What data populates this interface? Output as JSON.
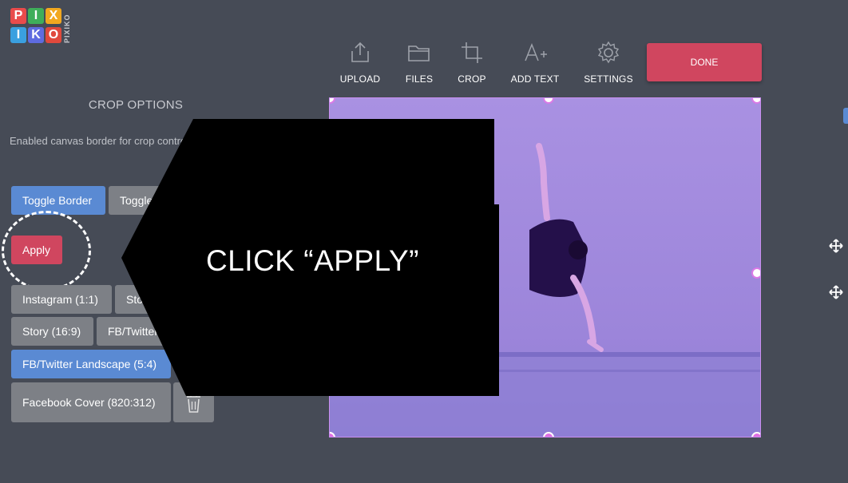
{
  "logo": {
    "letters": [
      "P",
      "I",
      "X",
      "I",
      "K",
      "O"
    ],
    "colors": [
      "#e94b4b",
      "#3fae5a",
      "#f2a81f",
      "#3aa0e0",
      "#5e6be0",
      "#e0493c"
    ],
    "vertical_text": "PIXIKO"
  },
  "toolbar": {
    "upload_label": "UPLOAD",
    "files_label": "FILES",
    "crop_label": "CROP",
    "add_text_label": "ADD TEXT",
    "settings_label": "SETTINGS",
    "done_label": "DONE"
  },
  "crop_panel": {
    "title": "CROP OPTIONS",
    "description": " Enabled canvas border for crop control.",
    "toggle_border_label": "Toggle Border",
    "toggle_second_label": "Toggle",
    "apply_label": "Apply",
    "presets": [
      {
        "label": "Instagram (1:1)"
      },
      {
        "label": "Story"
      },
      {
        "label": "Story (16:9)"
      },
      {
        "label": "FB/Twitter"
      },
      {
        "label": "FB/Twitter Landscape (5:4)"
      },
      {
        "label": "Facebook Cover (820:312)"
      }
    ]
  },
  "overlay": {
    "text": "CLICK “APPLY”"
  },
  "colors": {
    "background": "#464b56",
    "accent_red": "#d0465f",
    "accent_blue": "#5a8ad3",
    "button_gray": "#7d8086",
    "canvas_tint": "#a08ade"
  },
  "icons": [
    "upload-icon",
    "folder-icon",
    "crop-icon",
    "add-text-icon",
    "gear-icon",
    "trash-icon",
    "move-icon"
  ]
}
